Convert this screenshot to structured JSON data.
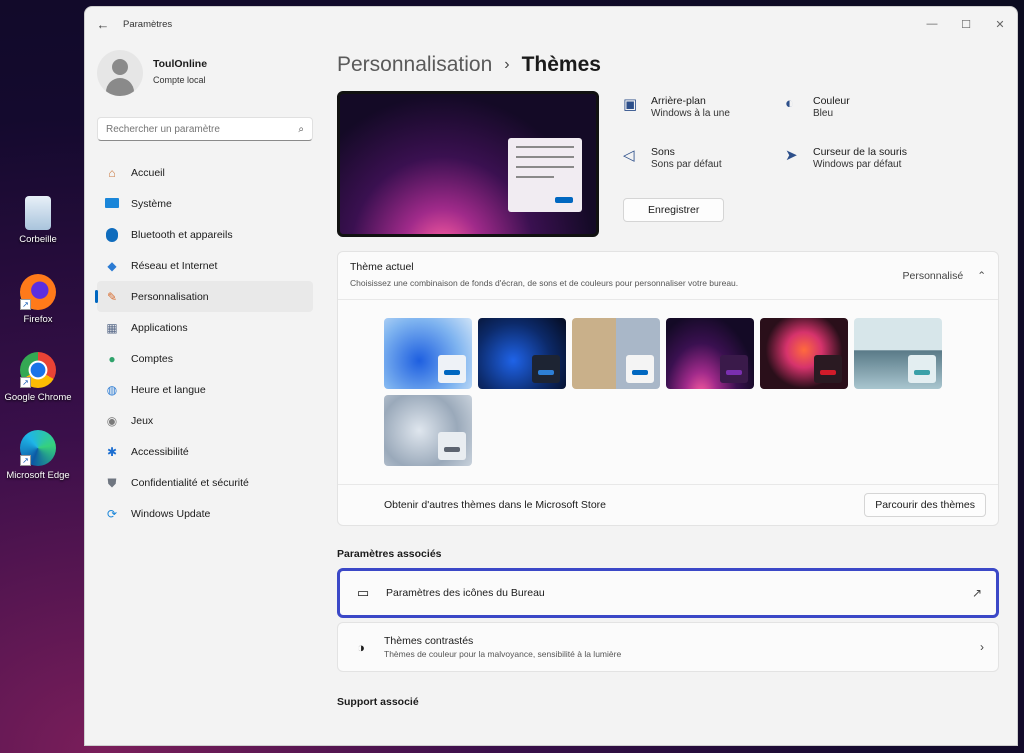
{
  "desktop": {
    "icons": [
      {
        "label": "Corbeille"
      },
      {
        "label": "Firefox"
      },
      {
        "label": "Google Chrome"
      },
      {
        "label": "Microsoft Edge"
      }
    ]
  },
  "window": {
    "title": "Paramètres",
    "controls": {
      "minimize": "—",
      "maximize": "☐",
      "close": "✕"
    },
    "back": "←"
  },
  "profile": {
    "name": "ToulOnline",
    "account_type": "Compte local"
  },
  "search": {
    "placeholder": "Rechercher un paramètre"
  },
  "nav": {
    "items": [
      {
        "label": "Accueil"
      },
      {
        "label": "Système"
      },
      {
        "label": "Bluetooth et appareils"
      },
      {
        "label": "Réseau et Internet"
      },
      {
        "label": "Personnalisation",
        "active": true
      },
      {
        "label": "Applications"
      },
      {
        "label": "Comptes"
      },
      {
        "label": "Heure et langue"
      },
      {
        "label": "Jeux"
      },
      {
        "label": "Accessibilité"
      },
      {
        "label": "Confidentialité et sécurité"
      },
      {
        "label": "Windows Update"
      }
    ]
  },
  "breadcrumb": {
    "parent": "Personnalisation",
    "separator": "›",
    "current": "Thèmes"
  },
  "theme_summary": {
    "background": {
      "label": "Arrière-plan",
      "value": "Windows à la une"
    },
    "color": {
      "label": "Couleur",
      "value": "Bleu"
    },
    "sounds": {
      "label": "Sons",
      "value": "Sons par défaut"
    },
    "cursor": {
      "label": "Curseur de la souris",
      "value": "Windows par défaut"
    },
    "save_label": "Enregistrer"
  },
  "current_theme": {
    "title": "Thème actuel",
    "description": "Choisissez une combinaison de fonds d'écran, de sons et de couleurs pour personnaliser votre bureau.",
    "value": "Personnalisé",
    "chevron": "⌃"
  },
  "store": {
    "text": "Obtenir d'autres thèmes dans le Microsoft Store",
    "button": "Parcourir des thèmes"
  },
  "related": {
    "title": "Paramètres associés",
    "desktop_icons": {
      "label": "Paramètres des icônes du Bureau",
      "end_icon": "↗"
    },
    "contrast": {
      "label": "Thèmes contrastés",
      "description": "Thèmes de couleur pour la malvoyance, sensibilité à la lumière",
      "end_icon": "›"
    }
  },
  "support": {
    "title": "Support associé"
  },
  "colors": {
    "accent": "#0067c0",
    "focus": "#3b48c7"
  }
}
